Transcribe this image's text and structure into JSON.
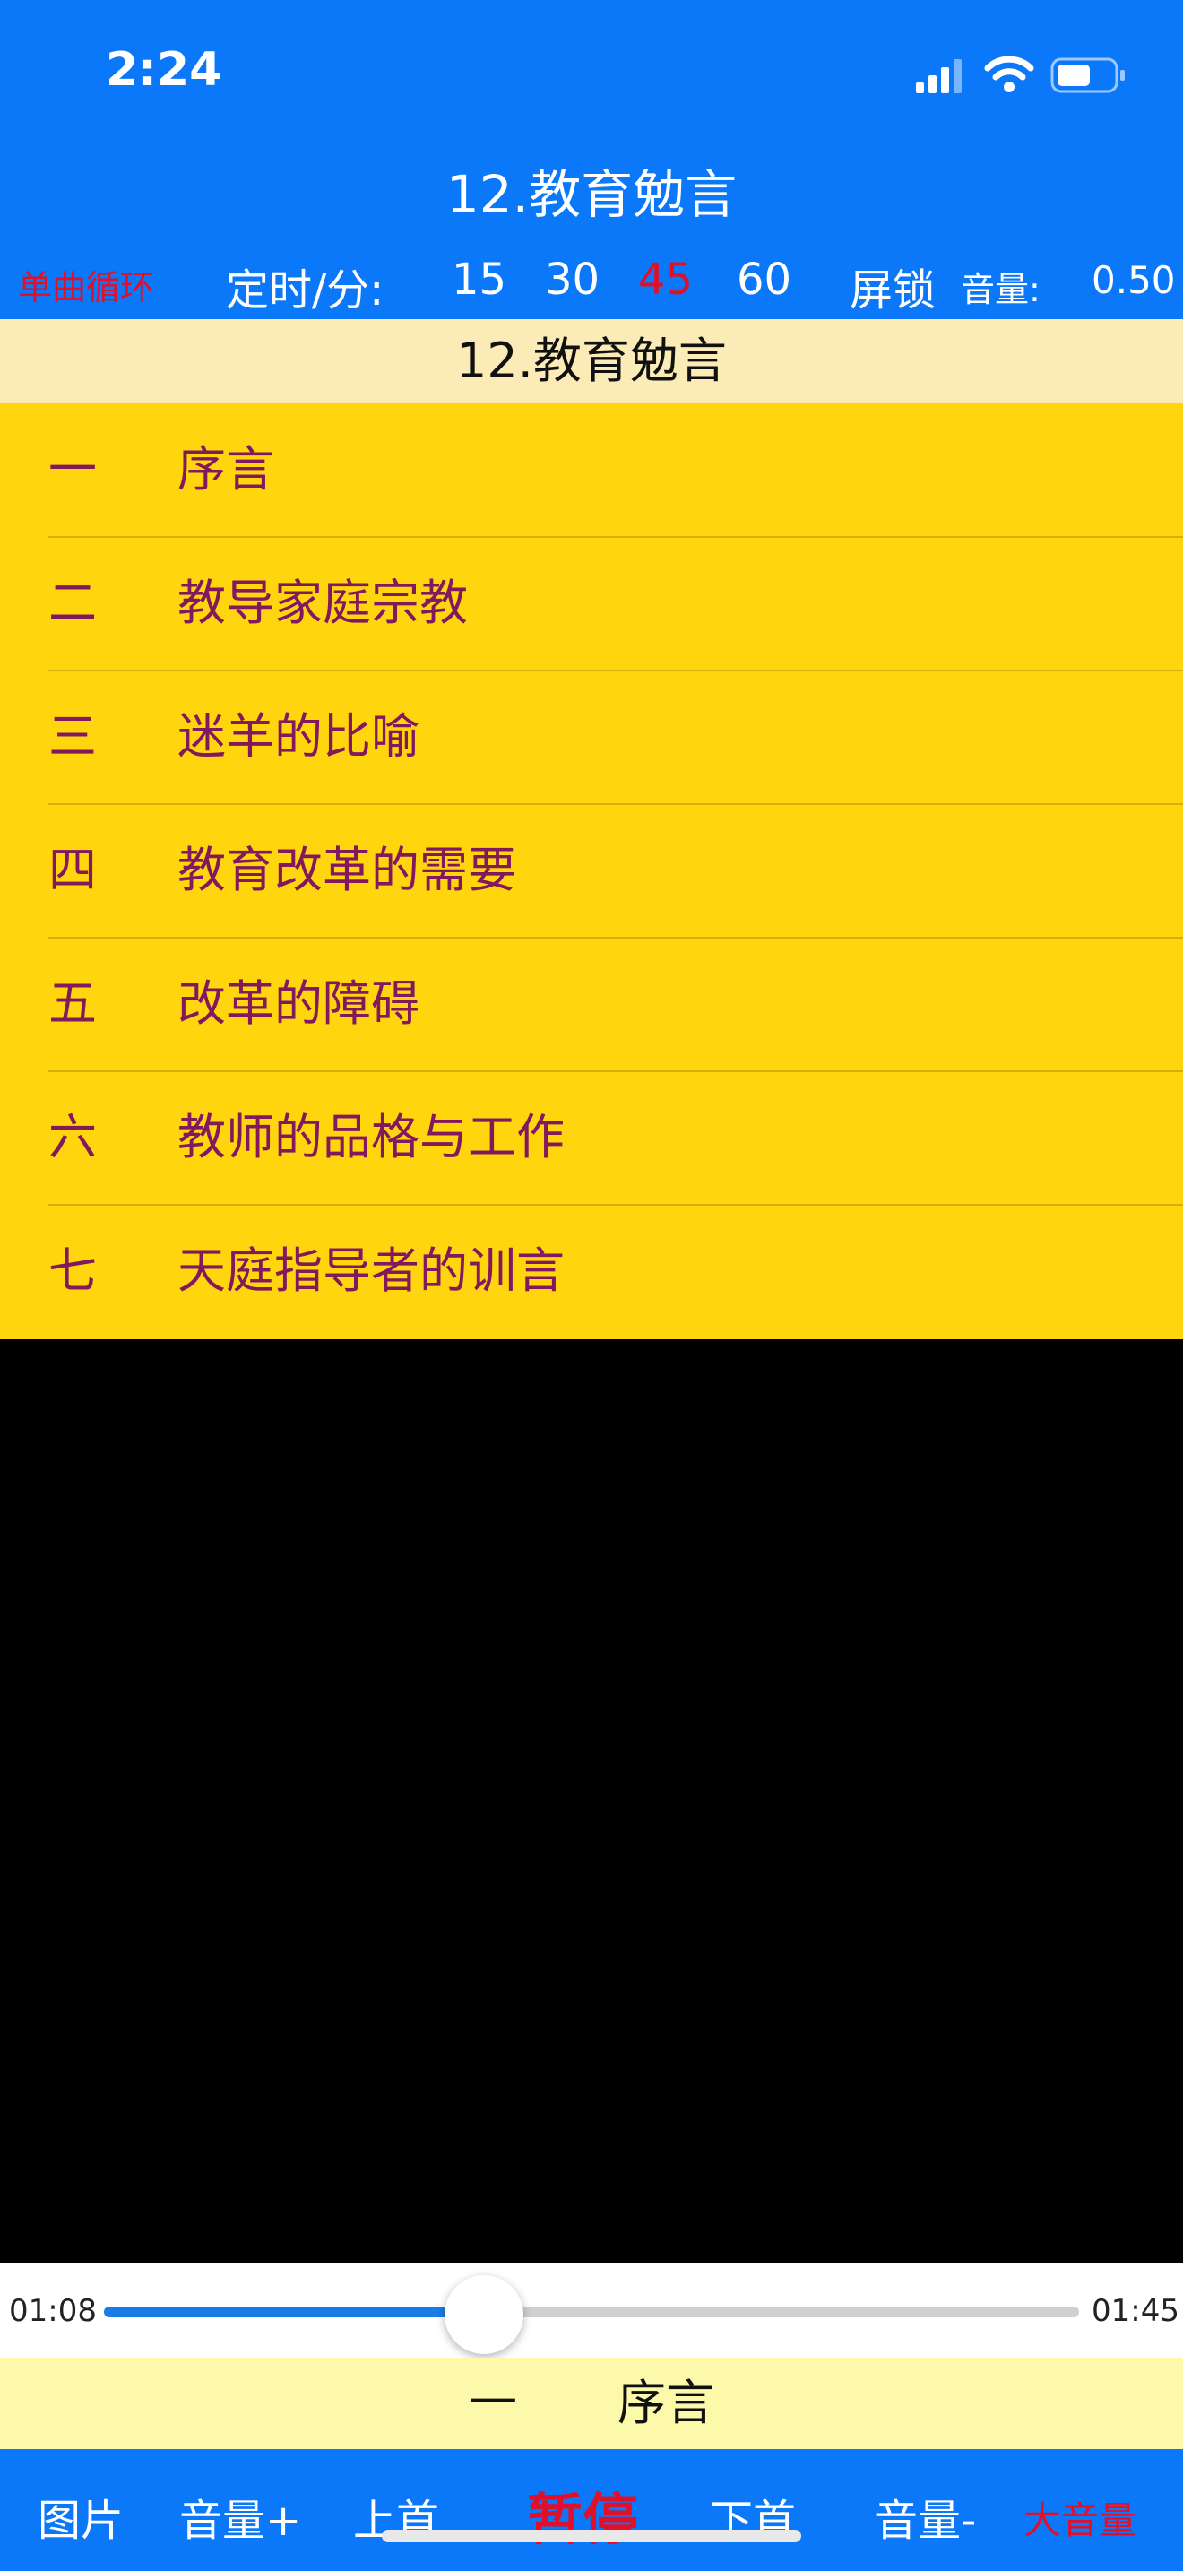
{
  "status_bar": {
    "time": "2:24"
  },
  "header": {
    "title": "12.教育勉言",
    "loop_mode": "单曲循环",
    "timer_label": "定时/分:",
    "timer_options": [
      "15",
      "30",
      "45",
      "60"
    ],
    "timer_selected": "45",
    "screen_lock": "屏锁",
    "volume_label": "音量:",
    "volume_value": "0.50"
  },
  "section_heading": "12.教育勉言",
  "chapters": [
    {
      "num": "一",
      "title": "序言"
    },
    {
      "num": "二",
      "title": "教导家庭宗教"
    },
    {
      "num": "三",
      "title": "迷羊的比喻"
    },
    {
      "num": "四",
      "title": "教育改革的需要"
    },
    {
      "num": "五",
      "title": "改革的障碍"
    },
    {
      "num": "六",
      "title": "教师的品格与工作"
    },
    {
      "num": "七",
      "title": "天庭指导者的训言"
    }
  ],
  "player": {
    "current_time": "01:08",
    "total_time": "01:45",
    "progress": 0.39
  },
  "now_playing": {
    "num": "一",
    "title": "序言"
  },
  "bottom_bar": {
    "picture": "图片",
    "volume_up": "音量+",
    "previous": "上首",
    "pause": "暂停",
    "next": "下首",
    "volume_down": "音量-",
    "loud_volume": "大音量"
  },
  "colors": {
    "header_bg": "#0A78F8",
    "list_bg": "#FFD60E",
    "chapter_text": "#82195D",
    "accent_red": "#E0102A"
  }
}
